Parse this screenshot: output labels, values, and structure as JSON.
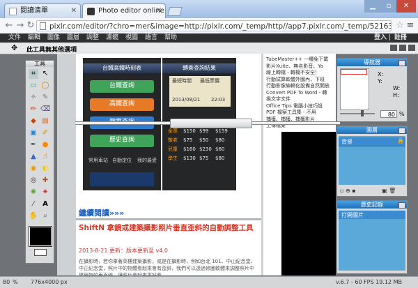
{
  "browser": {
    "tab1_label": "閱讀清單",
    "tab2_label": "Photo editor online / fre",
    "url": "pixlr.com/editor/?chro=mer&image=http://pixlr.com/_temp/http//app7.pixlr.com/_temp/521635d926ece2525f"
  },
  "menu": {
    "items": [
      "文件",
      "編輯",
      "圖像",
      "圖層",
      "調整",
      "濾鏡",
      "視圖",
      "語言",
      "幫助"
    ],
    "login": "登入",
    "divider": "|",
    "register": "註冊"
  },
  "options": {
    "text": "此工具無其他選項"
  },
  "tools": {
    "title": "工具"
  },
  "document": {
    "phone1_title": "台鐵高鐵時刻表",
    "phone1_buttons": [
      "台鐵查詢",
      "高鐵查詢",
      "轉乘查詢",
      "歷史查詢"
    ],
    "phone1_footer": [
      "常用車站",
      "自動定位",
      "我的最愛"
    ],
    "phone2_title": "轉乘查詢結果",
    "phone2_tabs": [
      "最短時間",
      "最低票價"
    ],
    "phone2_date": "2013/08/21",
    "phone2_time": "22:03",
    "phone2_rows": [
      [
        "全票",
        "$150",
        "$99",
        "$159"
      ],
      [
        "敬老",
        "$75",
        "$50",
        "$80"
      ],
      [
        "兒童",
        "$160",
        "$230",
        "$60"
      ],
      [
        "學生",
        "$130",
        "$75",
        "$80"
      ]
    ],
    "read_more": "繼續閱讀»»»",
    "article_title": "ShiftN 拿鏡或建築攝影照片垂直歪斜的自動調整工具",
    "article_meta": "2013-8-21 更新：版本更新至 v4.0",
    "article_body": "在攝影時，若你拿著高樓建築攝影，或是在攝影時，例如台北 101、中山紀念堂、中正紀念堂，照片中的物體看起來會有歪斜，我們可以透過修圖軟體來調整照片中建築物的垂直線，讓照片看起來更好看。"
  },
  "right_text": {
    "lines": [
      "TubeMaster++ 一種免下載",
      "影片Xuite、無名影音、Ya",
      "線上轉檔 - 轉檔不安全！",
      "行動試算軟體外國內，下班",
      "行動影像編輯化設備自然開放",
      "Convert PDF To Word - 轉",
      "換文字文件",
      "Office Tips 電腦小技巧設",
      "PDF 檔案工具集 - 不用",
      "捕獲、捕獲、捕獲影片",
      "上傳檔案"
    ]
  },
  "navigator": {
    "title": "導航器",
    "x_label": "X:",
    "y_label": "Y:",
    "w_label": "W:",
    "h_label": "H:",
    "zoom": "80",
    "zoom_unit": "%"
  },
  "layers": {
    "title": "圖層",
    "layer_name": "背景"
  },
  "history": {
    "title": "歷史記錄",
    "item": "打開圖片"
  },
  "status": {
    "zoom": "80",
    "zoom_unit": "%",
    "size": "776x4000 px",
    "fps": "v.6.7 - 60 FPS 19.12 MB"
  },
  "colors": {
    "accent": "#2a7fd4",
    "menubar": "#2d2f31",
    "link": "#1a5fc0",
    "title_red": "#d43a2a"
  }
}
